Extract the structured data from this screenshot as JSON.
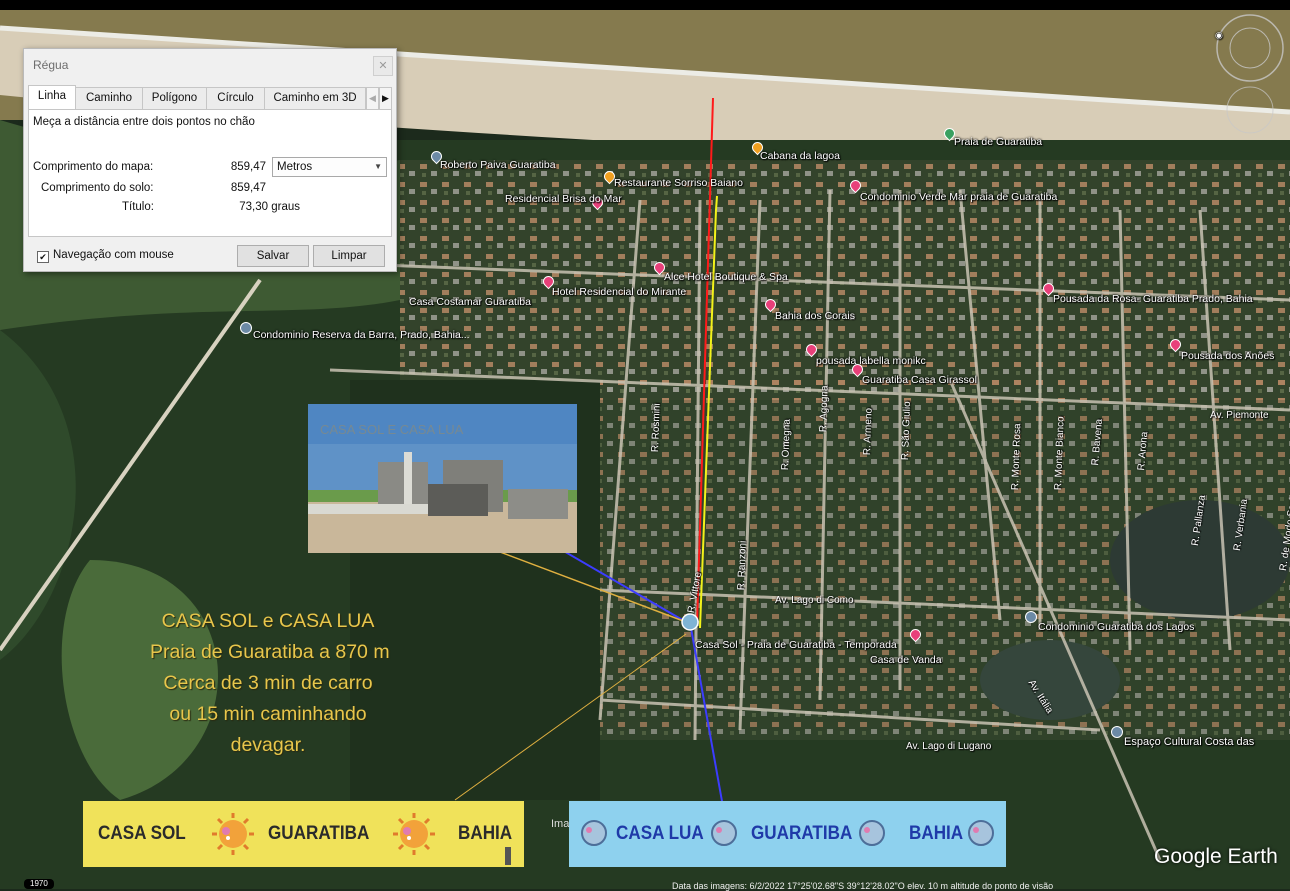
{
  "dialog": {
    "title": "Régua",
    "close": "✕",
    "tabs": [
      "Linha",
      "Caminho",
      "Polígono",
      "Círculo",
      "Caminho em 3D"
    ],
    "tab_prev": "◀",
    "tab_next": "▶",
    "description": "Meça a distância entre dois pontos no chão",
    "map_length_label": "Comprimento do mapa:",
    "map_length_value": "859,47",
    "unit": "Metros",
    "ground_length_label": "Comprimento do solo:",
    "ground_length_value": "859,47",
    "heading_label": "Título:",
    "heading_value": "73,30 graus",
    "mouse_nav_checked": "✔",
    "mouse_nav_label": "Navegação com mouse",
    "save": "Salvar",
    "clear": "Limpar"
  },
  "places": [
    "Roberto Paiva Guaratiba",
    "Restaurante Sorriso Baiano",
    "Cabana da lagoa",
    "Praia de Guaratiba",
    "Residencial Brisa do Mar",
    "Condominio Verde Mar praia de Guaratiba",
    "Alce Hotel Boutique & Spa",
    "Casa Costamar Guaratiba",
    "Hotel Residencial do Mirante",
    "Pousada da Rosa- Guaratiba Prado, Bahia",
    "Condominio Reserva da Barra, Prado, Bahia...",
    "Bahia dos Corais",
    "pousada labella monikc",
    "Pousada dos Anões",
    "Guaratiba Casa Girassol",
    "Casa Sol - Praia de Guaratiba - Temporada",
    "Casa de Vanda",
    "Condominio Guaratiba dos Lagos",
    "Espaço Cultural Costa das"
  ],
  "streets": {
    "piemonte": "Av. Piemonte",
    "lago_como": "Av. Lago di Como",
    "lago_lugano": "Av. Lago di Lugano",
    "italia": "Av. Itália",
    "rosmini": "R. Rosmini",
    "vittore": "R. Vittore",
    "ranzoni": "R. Ranzoni",
    "omegna": "R. Omegna",
    "agogna": "R. Agogna",
    "armeno": "R. Armeno",
    "sao_giulio": "R. São Giulio",
    "monte_rosa": "R. Monte Rosa",
    "monte_bianco": "R. Monte Bianco",
    "bavena": "R. Bavena",
    "arona": "R. Arona",
    "pallanza": "R. Pallanza",
    "verbania": "R. Verbania",
    "modo_sesia": "R. de Modo Sesia"
  },
  "photo_caption": "CASA SOL  E CASA LUA",
  "info_text": [
    "CASA SOL e CASA LUA",
    "Praia de Guaratiba a 870 m",
    "Cerca de 3 min de carro",
    "ou 15 min caminhando",
    "devagar."
  ],
  "banner_sol": [
    "CASA SOL",
    "GUARATIBA",
    "BAHIA"
  ],
  "banner_lua": [
    "CASA LUA",
    "GUARATIBA",
    "BAHIA"
  ],
  "ima_fragment": "Ima",
  "google_earth": "Google Earth",
  "year": "1970",
  "imagery_info": "Data das imagens: 6/2/2022      17°25'02.68\"S    39°12'28.02\"O   elev.   10 m     altitude do ponto de visão",
  "colors": {
    "ruler_line": "#ff1a1a",
    "yellow_path": "#f2f21a",
    "pointer_line": "#3c3cff",
    "banner_sol": "#f0e25a",
    "banner_lua": "#8ed1ee",
    "info_text": "#e8c64b",
    "place_pin": "#e8407a"
  }
}
